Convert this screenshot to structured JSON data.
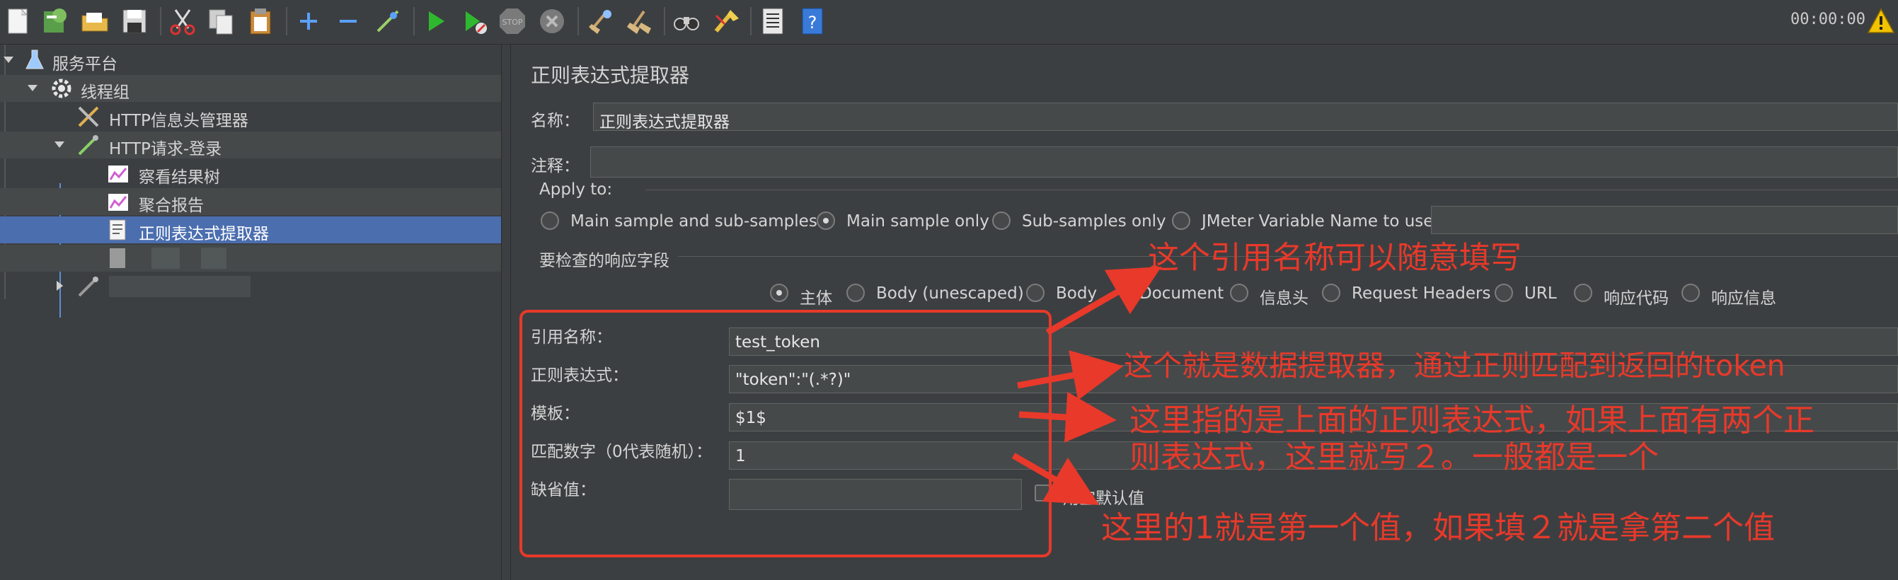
{
  "toolbar": {
    "timer": "00:00:00",
    "icons": [
      "new-icon",
      "templates-icon",
      "open-icon",
      "save-icon",
      "cut-icon",
      "copy-icon",
      "paste-icon",
      "expand-icon",
      "collapse-icon",
      "toggle-icon",
      "start-icon",
      "start-no-pause-icon",
      "stop-icon",
      "shutdown-icon",
      "clear-icon",
      "clear-all-icon",
      "search-icon",
      "reset-search-icon",
      "function-helper-icon",
      "help-icon"
    ],
    "warning_icon": "warning-icon"
  },
  "tree": {
    "items": [
      {
        "label": "服务平台",
        "icon": "test-plan-icon"
      },
      {
        "label": "线程组",
        "icon": "thread-group-icon"
      },
      {
        "label": "HTTP信息头管理器",
        "icon": "header-manager-icon"
      },
      {
        "label": "HTTP请求-登录",
        "icon": "http-sampler-icon"
      },
      {
        "label": "察看结果树",
        "icon": "listener-icon"
      },
      {
        "label": "聚合报告",
        "icon": "listener-icon"
      },
      {
        "label": "正则表达式提取器",
        "icon": "extractor-icon"
      },
      {
        "label": "",
        "icon": "blurred-item-icon"
      },
      {
        "label": "",
        "icon": "http-sampler-icon"
      }
    ],
    "selected_index": 6
  },
  "panel": {
    "title": "正则表达式提取器",
    "name_label": "名称：",
    "name_value": "正则表达式提取器",
    "comment_label": "注释：",
    "comment_value": "",
    "apply_to_label": "Apply to:",
    "apply_to_options": [
      "Main sample and sub-samples",
      "Main sample only",
      "Sub-samples only",
      "JMeter Variable Name to use"
    ],
    "apply_to_selected": 1,
    "field_label": "要检查的响应字段",
    "field_options": [
      "主体",
      "Body (unescaped)",
      "Body",
      "Document",
      "信息头",
      "Request Headers",
      "URL",
      "响应代码",
      "响应信息"
    ],
    "field_selected": 0,
    "ref_name_label": "引用名称：",
    "ref_name_value": "test_token",
    "regex_label": "正则表达式：",
    "regex_value": "\"token\":\"(.*?)\"",
    "template_label": "模板：",
    "template_value": "$1$",
    "match_no_label": "匹配数字（0代表随机）：",
    "match_no_value": "1",
    "default_label": "缺省值：",
    "default_value": "",
    "use_empty_default_label": "用空默认值"
  },
  "annotations": {
    "color": "#e8392a",
    "note1": "这个引用名称可以随意填写",
    "note2": "这个就是数据提取器，通过正则匹配到返回的token",
    "note3_line1": "这里指的是上面的正则表达式，如果上面有两个正",
    "note3_line2": "则表达式，这里就写２。一般都是一个",
    "note4": "这里的1就是第一个值，如果填２就是拿第二个值"
  }
}
